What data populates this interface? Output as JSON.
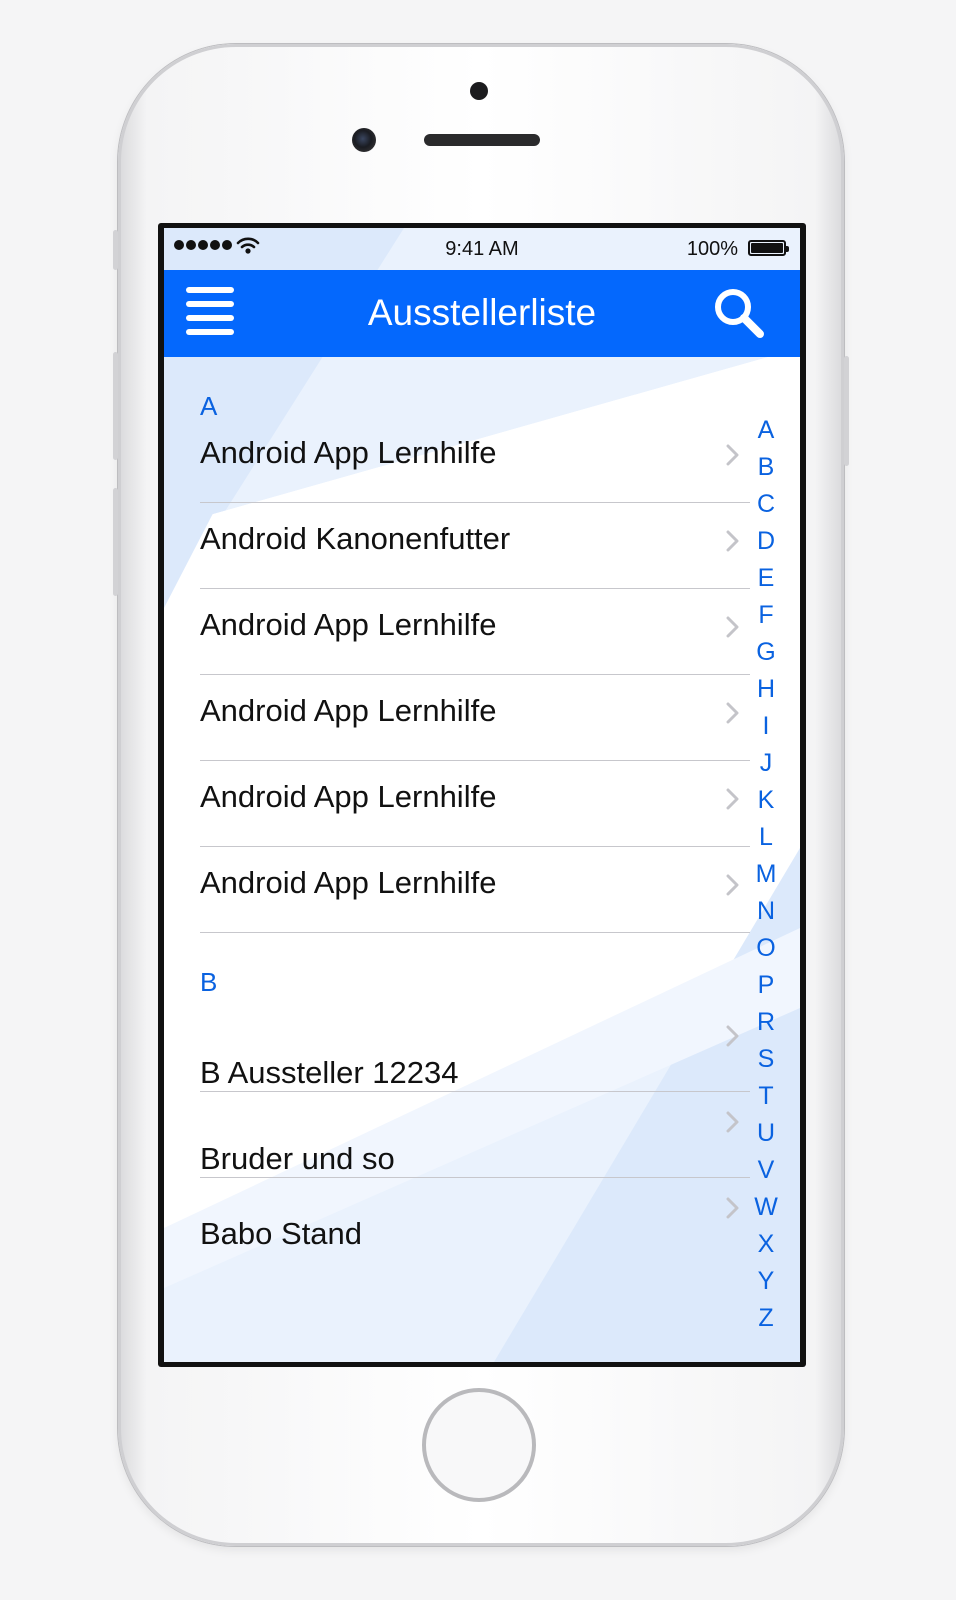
{
  "status_bar": {
    "time": "9:41 AM",
    "battery": "100%"
  },
  "navbar": {
    "title": "Ausstellerliste",
    "menu_icon": "hamburger-icon",
    "search_icon": "search-icon",
    "color": "#0468fd"
  },
  "sections": [
    {
      "header": "A",
      "items": [
        "Android App Lernhilfe",
        "Android Kanonenfutter",
        "Android App Lernhilfe",
        "Android App Lernhilfe",
        "Android App Lernhilfe",
        "Android App Lernhilfe"
      ]
    },
    {
      "header": "B",
      "items": [
        "B Aussteller 12234",
        "Bruder und so",
        "Babo Stand"
      ]
    }
  ],
  "index_letters": [
    "A",
    "B",
    "C",
    "D",
    "E",
    "F",
    "G",
    "H",
    "I",
    "J",
    "K",
    "L",
    "M",
    "N",
    "O",
    "P",
    "R",
    "S",
    "T",
    "U",
    "V",
    "W",
    "X",
    "Y",
    "Z"
  ],
  "accent_color": "#0a62e0"
}
